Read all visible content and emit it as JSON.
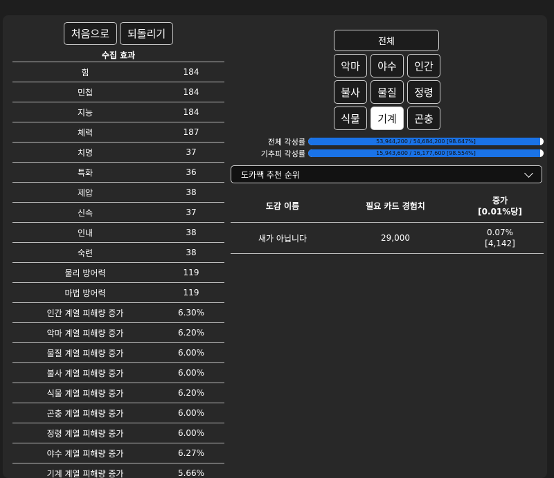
{
  "buttons": {
    "reset": "처음으로",
    "undo": "되돌리기"
  },
  "stats_title": "수집 효과",
  "stats": [
    {
      "name": "힘",
      "value": "184"
    },
    {
      "name": "민첩",
      "value": "184"
    },
    {
      "name": "지능",
      "value": "184"
    },
    {
      "name": "체력",
      "value": "187"
    },
    {
      "name": "치명",
      "value": "37"
    },
    {
      "name": "특화",
      "value": "36"
    },
    {
      "name": "제압",
      "value": "38"
    },
    {
      "name": "신속",
      "value": "37"
    },
    {
      "name": "인내",
      "value": "38"
    },
    {
      "name": "숙련",
      "value": "38"
    },
    {
      "name": "물리 방어력",
      "value": "119"
    },
    {
      "name": "마법 방어력",
      "value": "119"
    },
    {
      "name": "인간 계열 피해량 증가",
      "value": "6.30%"
    },
    {
      "name": "악마 계열 피해량 증가",
      "value": "6.20%"
    },
    {
      "name": "물질 계열 피해량 증가",
      "value": "6.00%"
    },
    {
      "name": "불사 계열 피해량 증가",
      "value": "6.00%"
    },
    {
      "name": "식물 계열 피해량 증가",
      "value": "6.20%"
    },
    {
      "name": "곤충 계열 피해량 증가",
      "value": "6.00%"
    },
    {
      "name": "정령 계열 피해량 증가",
      "value": "6.00%"
    },
    {
      "name": "야수 계열 피해량 증가",
      "value": "6.27%"
    },
    {
      "name": "기계 계열 피해량 증가",
      "value": "5.66%"
    }
  ],
  "categories": {
    "all": "전체",
    "rows": [
      [
        "악마",
        "야수",
        "인간"
      ],
      [
        "불사",
        "물질",
        "정령"
      ],
      [
        "식물",
        "기계",
        "곤충"
      ]
    ],
    "active": "기계"
  },
  "progress": [
    {
      "label": "전체 각성률",
      "text": "53,944,200 / 54,684,200 [98.647%]",
      "fraction": 0.98647
    },
    {
      "label": "기추피 각성률",
      "text": "15,943,600 / 16,177,600 [98.554%]",
      "fraction": 0.98554
    }
  ],
  "sort": {
    "selected": "도카짹 추천 순위"
  },
  "recommend": {
    "headers": [
      "도감 이름",
      "필요 카드 경험치",
      "증가\n[0.01%당]"
    ],
    "rows": [
      {
        "name": "새가 아닙니다",
        "exp": "29,000",
        "gain": "0.07%\n[4,142]"
      }
    ]
  }
}
